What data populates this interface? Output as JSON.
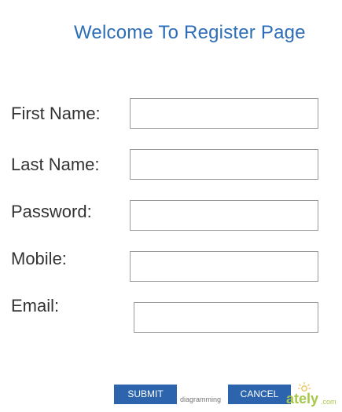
{
  "header": {
    "title": "Welcome To Register Page"
  },
  "form": {
    "first_name": {
      "label": "First Name:",
      "value": "",
      "placeholder": ""
    },
    "last_name": {
      "label": "Last Name:",
      "value": "",
      "placeholder": ""
    },
    "password": {
      "label": "Password:",
      "value": "",
      "placeholder": ""
    },
    "mobile": {
      "label": "Mobile:",
      "value": "",
      "placeholder": ""
    },
    "email": {
      "label": "Email:",
      "value": "",
      "placeholder": ""
    }
  },
  "actions": {
    "submit_label": "SUBMIT",
    "cancel_label": "CANCEL"
  },
  "watermark": {
    "prefix": "diagramming",
    "brand": "ately",
    "suffix": ".com",
    "icon": "sun-icon"
  },
  "colors": {
    "title": "#2d6db7",
    "button": "#2c64ad",
    "watermark": "#a8c64a"
  }
}
